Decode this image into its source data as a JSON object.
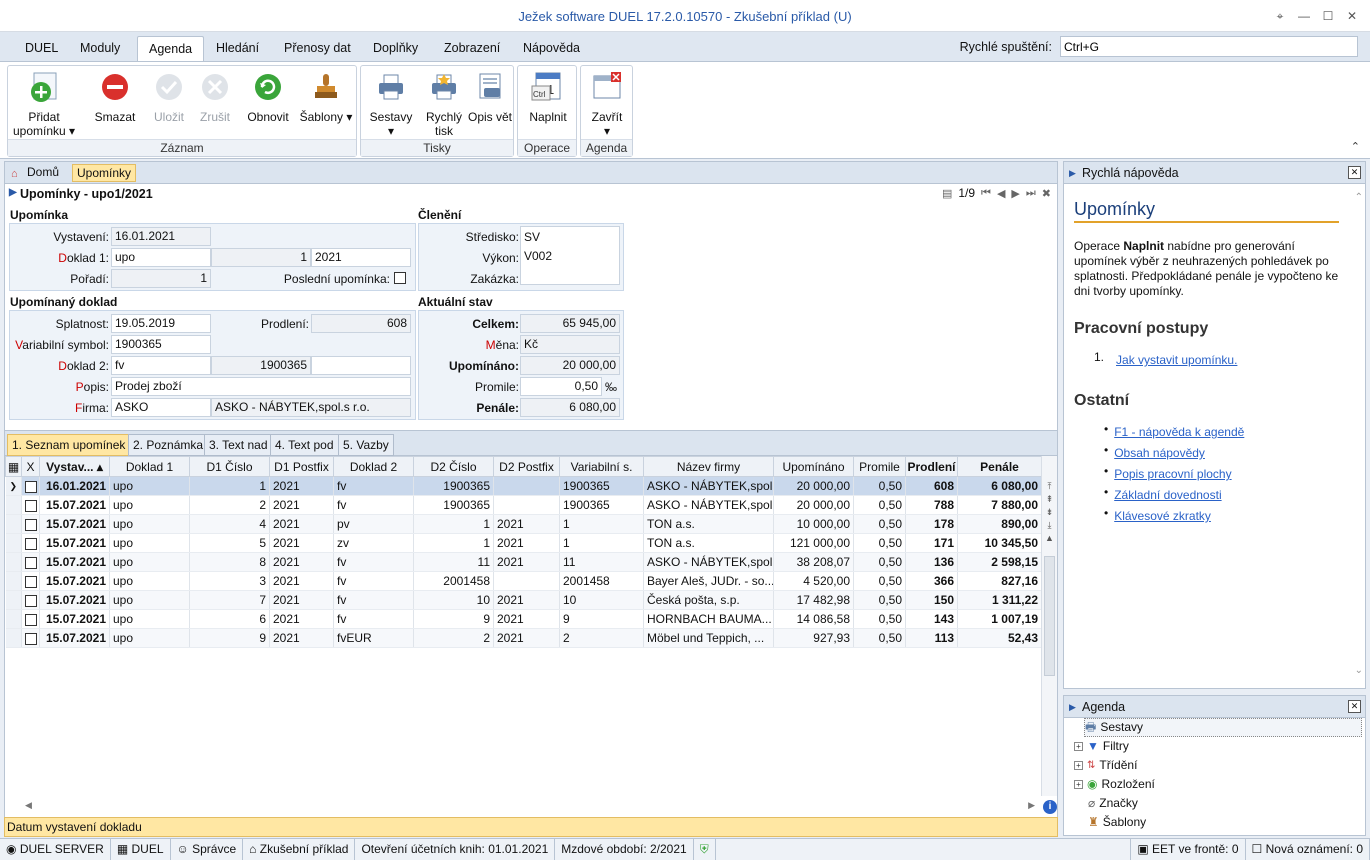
{
  "window": {
    "title": "Ježek software DUEL 17.2.0.10570 - Zkušební příklad (U)"
  },
  "menu": [
    "DUEL",
    "Moduly",
    "Agenda",
    "Hledání",
    "Přenosy dat",
    "Doplňky",
    "Zobrazení",
    "Nápověda"
  ],
  "menu_active": "Agenda",
  "quick": {
    "label": "Rychlé spuštění:",
    "value": "Ctrl+G"
  },
  "ribbon": {
    "zaznam": {
      "label": "Záznam",
      "pridat": "Přidat upomínku",
      "smazat": "Smazat",
      "ulozit": "Uložit",
      "zrusit": "Zrušit",
      "obnovit": "Obnovit",
      "sablony": "Šablony"
    },
    "tisky": {
      "label": "Tisky",
      "sestavy": "Sestavy",
      "rychly": "Rychlý tisk",
      "opis": "Opis vět"
    },
    "operace": {
      "label": "Operace",
      "naplnit": "Naplnit",
      "ctrl": "Ctrl"
    },
    "agenda": {
      "label": "Agenda",
      "zavrit": "Zavřít"
    }
  },
  "breadcrumb": {
    "home": "Domů",
    "current": "Upomínky"
  },
  "record": {
    "title": "Upomínky - upo1/2021",
    "position": "1/9"
  },
  "form": {
    "upominka": {
      "heading": "Upomínka",
      "vystaveni_label": "Vystavení:",
      "vystaveni": "16.01.2021",
      "doklad1_label": "Doklad 1:",
      "doklad1_type": "upo",
      "doklad1_num": "1",
      "doklad1_year": "2021",
      "poradi_label": "Pořadí:",
      "poradi": "1",
      "posledni_label": "Poslední upomínka:"
    },
    "cleneni": {
      "heading": "Členění",
      "stredisko_label": "Středisko:",
      "stredisko": "SV",
      "vykon_label": "Výkon:",
      "vykon": "V002",
      "zakazka_label": "Zakázka:"
    },
    "doklad": {
      "heading": "Upomínaný doklad",
      "splatnost_label": "Splatnost:",
      "splatnost": "19.05.2019",
      "prodleni_label": "Prodlení:",
      "prodleni": "608",
      "vs_label": "Variabilní symbol:",
      "vs": "1900365",
      "doklad2_label": "Doklad 2:",
      "doklad2_type": "fv",
      "doklad2_num": "1900365",
      "popis_label": "Popis:",
      "popis": "Prodej zboží",
      "firma_label": "Firma:",
      "firma_code": "ASKO",
      "firma_name": "ASKO - NÁBYTEK,spol.s r.o."
    },
    "stav": {
      "heading": "Aktuální stav",
      "celkem_label": "Celkem:",
      "celkem": "65 945,00",
      "mena_label": "Měna:",
      "mena": "Kč",
      "upominano_label": "Upomínáno:",
      "upominano": "20 000,00",
      "promile_label": "Promile:",
      "promile": "0,50",
      "promile_unit": "‰",
      "penale_label": "Penále:",
      "penale": "6 080,00"
    }
  },
  "tabs": [
    "1. Seznam upomínek",
    "2. Poznámka",
    "3. Text nad",
    "4. Text pod",
    "5. Vazby"
  ],
  "table": {
    "columns": [
      "X",
      "Vystav...",
      "Doklad 1",
      "D1 Číslo",
      "D1 Postfix",
      "Doklad 2",
      "D2 Číslo",
      "D2 Postfix",
      "Variabilní s.",
      "Název firmy",
      "Upomínáno",
      "Promile",
      "Prodlení",
      "Penále"
    ],
    "rows": [
      [
        "16.01.2021",
        "upo",
        "1",
        "2021",
        "fv",
        "1900365",
        "",
        "1900365",
        "ASKO - NÁBYTEK,spol...",
        "20 000,00",
        "0,50",
        "608",
        "6 080,00"
      ],
      [
        "15.07.2021",
        "upo",
        "2",
        "2021",
        "fv",
        "1900365",
        "",
        "1900365",
        "ASKO - NÁBYTEK,spol...",
        "20 000,00",
        "0,50",
        "788",
        "7 880,00"
      ],
      [
        "15.07.2021",
        "upo",
        "4",
        "2021",
        "pv",
        "1",
        "2021",
        "1",
        "TON a.s.",
        "10 000,00",
        "0,50",
        "178",
        "890,00"
      ],
      [
        "15.07.2021",
        "upo",
        "5",
        "2021",
        "zv",
        "1",
        "2021",
        "1",
        "TON a.s.",
        "121 000,00",
        "0,50",
        "171",
        "10 345,50"
      ],
      [
        "15.07.2021",
        "upo",
        "8",
        "2021",
        "fv",
        "11",
        "2021",
        "11",
        "ASKO - NÁBYTEK,spol...",
        "38 208,07",
        "0,50",
        "136",
        "2 598,15"
      ],
      [
        "15.07.2021",
        "upo",
        "3",
        "2021",
        "fv",
        "2001458",
        "",
        "2001458",
        "Bayer Aleš, JUDr. - so...",
        "4 520,00",
        "0,50",
        "366",
        "827,16"
      ],
      [
        "15.07.2021",
        "upo",
        "7",
        "2021",
        "fv",
        "10",
        "2021",
        "10",
        "Česká pošta, s.p.",
        "17 482,98",
        "0,50",
        "150",
        "1 311,22"
      ],
      [
        "15.07.2021",
        "upo",
        "6",
        "2021",
        "fv",
        "9",
        "2021",
        "9",
        "HORNBACH BAUMA...",
        "14 086,58",
        "0,50",
        "143",
        "1 007,19"
      ],
      [
        "15.07.2021",
        "upo",
        "9",
        "2021",
        "fvEUR",
        "2",
        "2021",
        "2",
        "Möbel und Teppich, ...",
        "927,93",
        "0,50",
        "113",
        "52,43"
      ]
    ]
  },
  "status_hint": "Datum vystavení dokladu",
  "help": {
    "header": "Rychlá nápověda",
    "title": "Upomínky",
    "intro_pre": "Operace ",
    "intro_bold": "Naplnit",
    "intro_post": " nabídne pro generování upomínek výběr z neuhrazených pohledávek po splatnosti. Předpokládané penále je vypočteno ke dni tvorby upomínky.",
    "postupy_title": "Pracovní postupy",
    "postup_num": "1.",
    "postup_link": "Jak vystavit upomínku.",
    "ostatni_title": "Ostatní",
    "links": [
      "F1 - nápověda k agendě",
      "Obsah nápovědy",
      "Popis pracovní plochy",
      "Základní dovednosti",
      "Klávesové zkratky"
    ]
  },
  "agenda_panel": {
    "header": "Agenda",
    "items": [
      "Sestavy",
      "Filtry",
      "Třídění",
      "Rozložení",
      "Značky",
      "Šablony"
    ]
  },
  "statusbar": [
    "DUEL SERVER",
    "DUEL",
    "Správce",
    "Zkušební příklad",
    "Otevření účetních knih: 01.01.2021",
    "Mzdové období: 2/2021",
    "EET ve frontě: 0",
    "Nová oznámení: 0"
  ]
}
